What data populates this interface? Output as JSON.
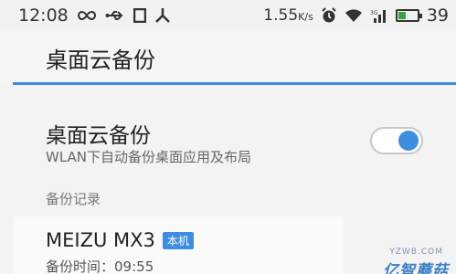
{
  "status_bar": {
    "time": "12:08",
    "net_speed": "1.55",
    "net_unit": "K/s",
    "battery": "39",
    "battery_level": 0.39,
    "icons": [
      "infinity-icon",
      "usb-icon",
      "square-icon",
      "share-icon",
      "alarm-icon",
      "wifi-icon",
      "signal-icon",
      "battery-icon"
    ]
  },
  "header": {
    "title": "桌面云备份"
  },
  "setting": {
    "title": "桌面云备份",
    "subtitle": "WLAN下自动备份桌面应用及布局",
    "enabled": true
  },
  "section": {
    "label": "备份记录"
  },
  "backup": {
    "device": "MEIZU MX3",
    "badge": "本机",
    "time_label": "备份时间：",
    "time": "09:55"
  },
  "watermark": {
    "url": "YZWB.COM",
    "logo": "亿智蘑菇"
  },
  "colors": {
    "accent": "#3d8de0",
    "battery_fill": "#3ca344"
  }
}
